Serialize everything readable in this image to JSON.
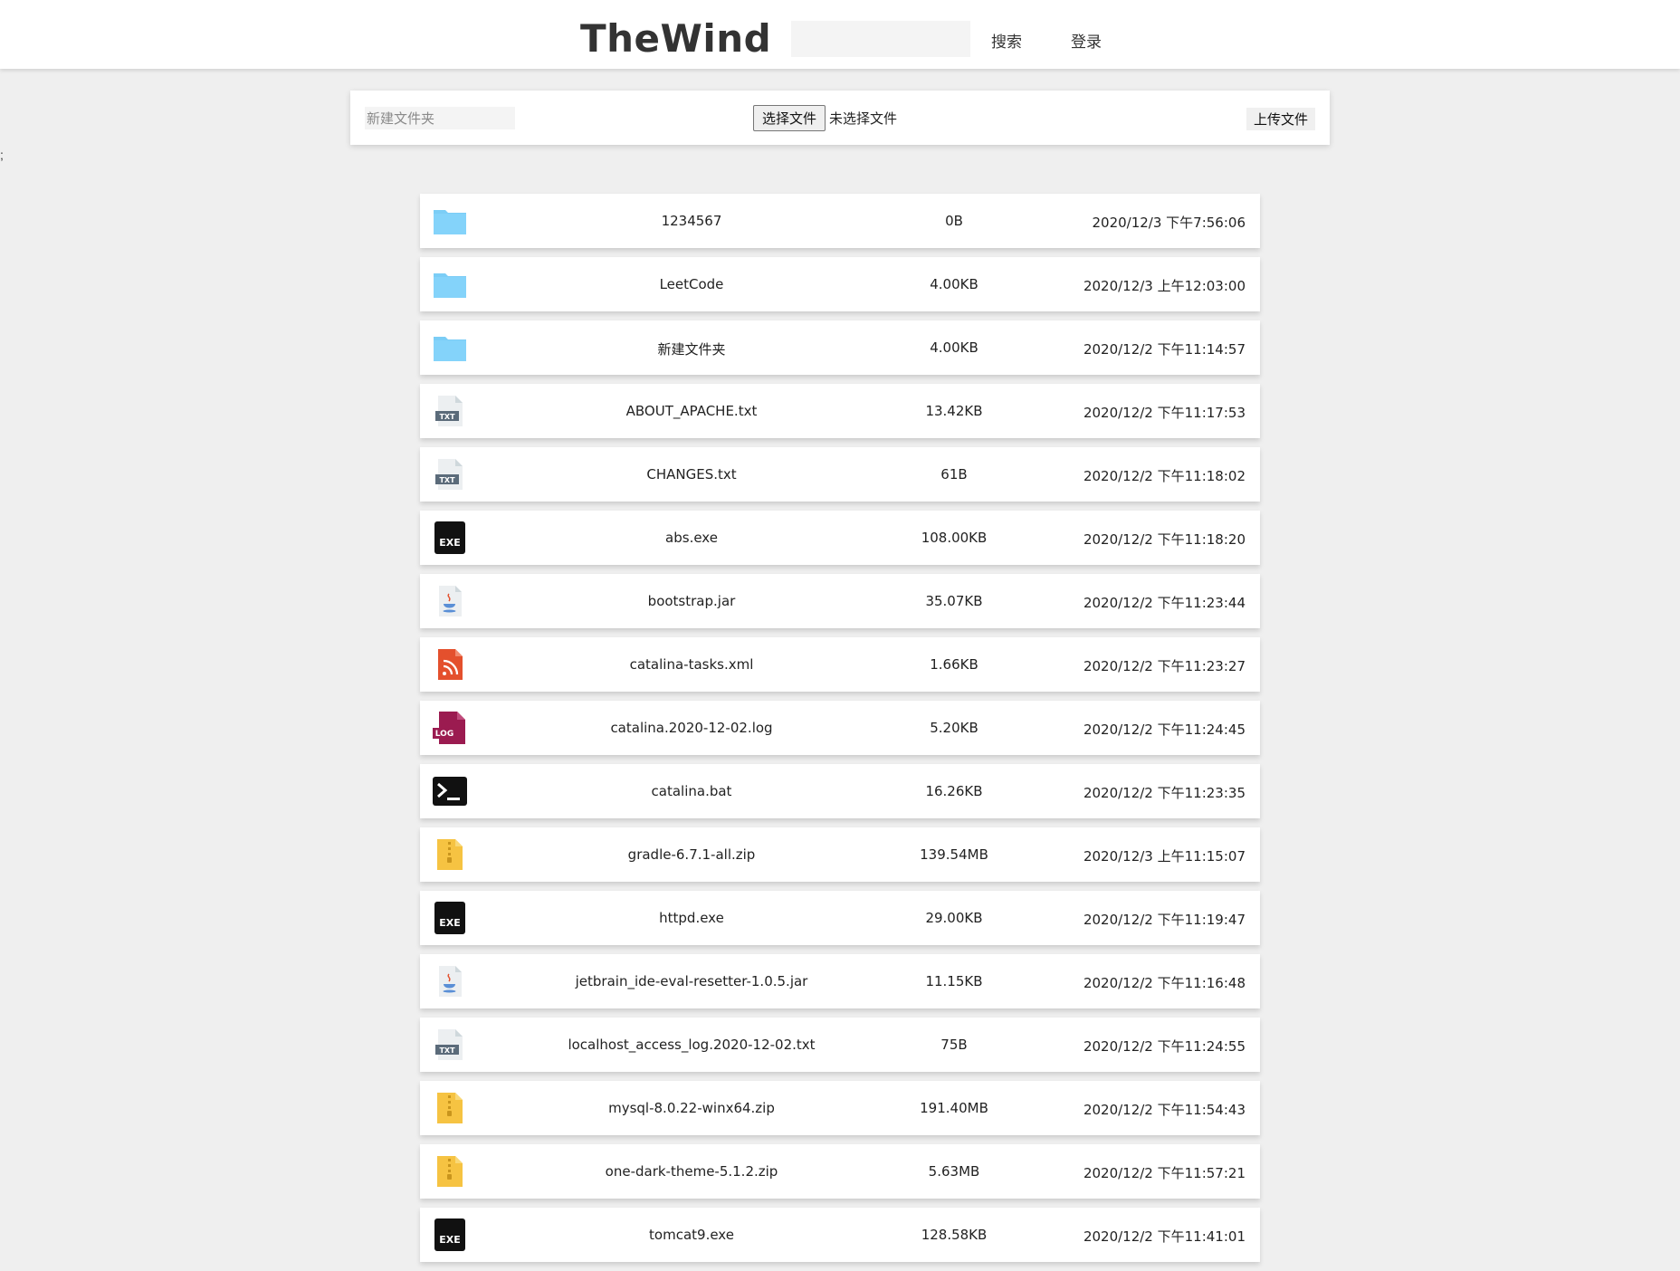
{
  "header": {
    "brand": "TheWind",
    "search_placeholder": "",
    "search_label": "搜索",
    "login_label": "登录"
  },
  "stray_text": ";",
  "toolbar": {
    "folder_placeholder": "新建文件夹",
    "choose_label": "选择文件",
    "no_file_label": "未选择文件",
    "upload_label": "上传文件"
  },
  "files": [
    {
      "icon": "folder-icon",
      "name": "1234567",
      "size": "0B",
      "date": "2020/12/3 下午7:56:06"
    },
    {
      "icon": "folder-icon",
      "name": "LeetCode",
      "size": "4.00KB",
      "date": "2020/12/3 上午12:03:00"
    },
    {
      "icon": "folder-icon",
      "name": "新建文件夹",
      "size": "4.00KB",
      "date": "2020/12/2 下午11:14:57"
    },
    {
      "icon": "txt-file-icon",
      "name": "ABOUT_APACHE.txt",
      "size": "13.42KB",
      "date": "2020/12/2 下午11:17:53"
    },
    {
      "icon": "txt-file-icon",
      "name": "CHANGES.txt",
      "size": "61B",
      "date": "2020/12/2 下午11:18:02"
    },
    {
      "icon": "exe-file-icon",
      "name": "abs.exe",
      "size": "108.00KB",
      "date": "2020/12/2 下午11:18:20"
    },
    {
      "icon": "jar-file-icon",
      "name": "bootstrap.jar",
      "size": "35.07KB",
      "date": "2020/12/2 下午11:23:44"
    },
    {
      "icon": "xml-file-icon",
      "name": "catalina-tasks.xml",
      "size": "1.66KB",
      "date": "2020/12/2 下午11:23:27"
    },
    {
      "icon": "log-file-icon",
      "name": "catalina.2020-12-02.log",
      "size": "5.20KB",
      "date": "2020/12/2 下午11:24:45"
    },
    {
      "icon": "bat-file-icon",
      "name": "catalina.bat",
      "size": "16.26KB",
      "date": "2020/12/2 下午11:23:35"
    },
    {
      "icon": "zip-file-icon",
      "name": "gradle-6.7.1-all.zip",
      "size": "139.54MB",
      "date": "2020/12/3 上午11:15:07"
    },
    {
      "icon": "exe-file-icon",
      "name": "httpd.exe",
      "size": "29.00KB",
      "date": "2020/12/2 下午11:19:47"
    },
    {
      "icon": "jar-file-icon",
      "name": "jetbrain_ide-eval-resetter-1.0.5.jar",
      "size": "11.15KB",
      "date": "2020/12/2 下午11:16:48"
    },
    {
      "icon": "txt-file-icon",
      "name": "localhost_access_log.2020-12-02.txt",
      "size": "75B",
      "date": "2020/12/2 下午11:24:55"
    },
    {
      "icon": "zip-file-icon",
      "name": "mysql-8.0.22-winx64.zip",
      "size": "191.40MB",
      "date": "2020/12/2 下午11:54:43"
    },
    {
      "icon": "zip-file-icon",
      "name": "one-dark-theme-5.1.2.zip",
      "size": "5.63MB",
      "date": "2020/12/2 下午11:57:21"
    },
    {
      "icon": "exe-file-icon",
      "name": "tomcat9.exe",
      "size": "128.58KB",
      "date": "2020/12/2 下午11:41:01"
    }
  ],
  "colors": {
    "background": "#efefef",
    "folder": "#7bcdf6",
    "zip": "#f6c342",
    "xml": "#e4502d",
    "log": "#9b1b50"
  }
}
